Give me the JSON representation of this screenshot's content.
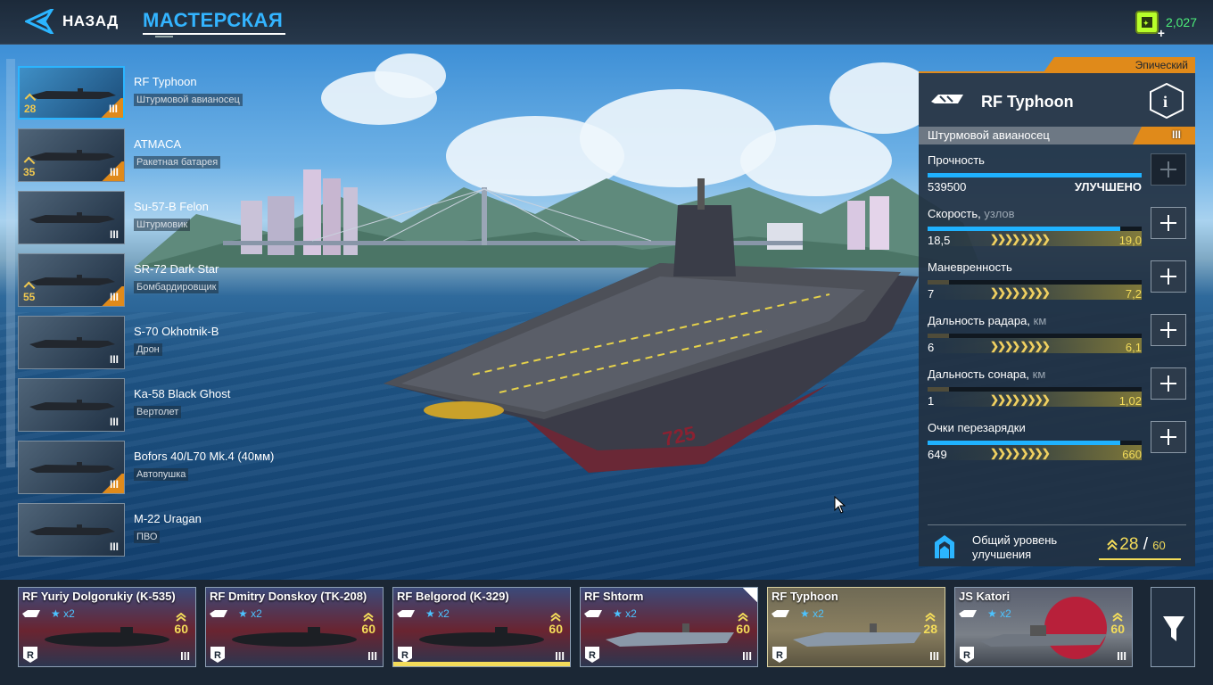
{
  "header": {
    "back_label": "НАЗАД",
    "title": "МАСТЕРСКАЯ",
    "currency_value": "2,027"
  },
  "ship_list": [
    {
      "name": "RF Typhoon",
      "type": "Штурмовой авианосец",
      "level": "28",
      "tier": "III",
      "selected": true,
      "tier_color": "orange"
    },
    {
      "name": "ATMACA",
      "type": "Ракетная батарея",
      "level": "35",
      "tier": "III",
      "selected": false,
      "tier_color": "orange"
    },
    {
      "name": "Su-57-B Felon",
      "type": "Штурмовик",
      "level": "",
      "tier": "III",
      "selected": false,
      "tier_color": "blue"
    },
    {
      "name": "SR-72 Dark Star",
      "type": "Бомбардировщик",
      "level": "55",
      "tier": "III",
      "selected": false,
      "tier_color": "orange"
    },
    {
      "name": "S-70 Okhotnik-B",
      "type": "Дрон",
      "level": "",
      "tier": "III",
      "selected": false,
      "tier_color": "blue"
    },
    {
      "name": "Ka-58 Black Ghost",
      "type": "Вертолет",
      "level": "",
      "tier": "III",
      "selected": false,
      "tier_color": "blue"
    },
    {
      "name": "Bofors 40/L70 Mk.4 (40мм)",
      "type": "Автопушка",
      "level": "",
      "tier": "III",
      "selected": false,
      "tier_color": "orange"
    },
    {
      "name": "M-22 Uragan",
      "type": "ПВО",
      "level": "",
      "tier": "III",
      "selected": false,
      "tier_color": "blue"
    }
  ],
  "panel": {
    "rarity": "Эпический",
    "ship_name": "RF Typhoon",
    "ship_type": "Штурмовой авианосец",
    "tier": "III",
    "stats": [
      {
        "label": "Прочность",
        "unit": "",
        "current": "539500",
        "max": "",
        "status": "УЛУЧШЕНО",
        "fill": 1.0,
        "can_upgrade": false
      },
      {
        "label": "Скорость,",
        "unit": "узлов",
        "current": "18,5",
        "max": "19,0",
        "status": "",
        "fill": 0.9,
        "can_upgrade": true
      },
      {
        "label": "Маневренность",
        "unit": "",
        "current": "7",
        "max": "7,2",
        "status": "",
        "fill": 0.1,
        "can_upgrade": true
      },
      {
        "label": "Дальность радара,",
        "unit": "км",
        "current": "6",
        "max": "6,1",
        "status": "",
        "fill": 0.1,
        "can_upgrade": true
      },
      {
        "label": "Дальность сонара,",
        "unit": "км",
        "current": "1",
        "max": "1,02",
        "status": "",
        "fill": 0.1,
        "can_upgrade": true
      },
      {
        "label": "Очки перезарядки",
        "unit": "",
        "current": "649",
        "max": "660",
        "status": "",
        "fill": 0.9,
        "can_upgrade": true
      }
    ],
    "total_label": "Общий уровень улучшения",
    "total_current": "28",
    "total_sep": "/",
    "total_max": "60"
  },
  "fleet": [
    {
      "name": "RF Yuriy Dolgorukiy (K-535)",
      "stars": "x2",
      "level": "60",
      "tier": "III",
      "kind": "sub",
      "flag": "ru"
    },
    {
      "name": "RF Dmitry Donskoy (TK-208)",
      "stars": "x2",
      "level": "60",
      "tier": "III",
      "kind": "sub",
      "flag": "ru"
    },
    {
      "name": "RF Belgorod (K-329)",
      "stars": "x2",
      "level": "60",
      "tier": "III",
      "kind": "sub",
      "flag": "ru",
      "highlight": true
    },
    {
      "name": "RF Shtorm",
      "stars": "x2",
      "level": "60",
      "tier": "III",
      "kind": "carrier",
      "flag": "ru",
      "corner": true
    },
    {
      "name": "RF Typhoon",
      "stars": "x2",
      "level": "28",
      "tier": "III",
      "kind": "carrier",
      "flag": "ru",
      "selected": true
    },
    {
      "name": "JS Katori",
      "stars": "x2",
      "level": "60",
      "tier": "III",
      "kind": "destroyer",
      "flag": "jp"
    }
  ],
  "colors": {
    "accent_blue": "#1fb2ff",
    "epic_orange": "#e08a1a",
    "gold": "#f3dc5a",
    "currency_green": "#4df07a"
  }
}
